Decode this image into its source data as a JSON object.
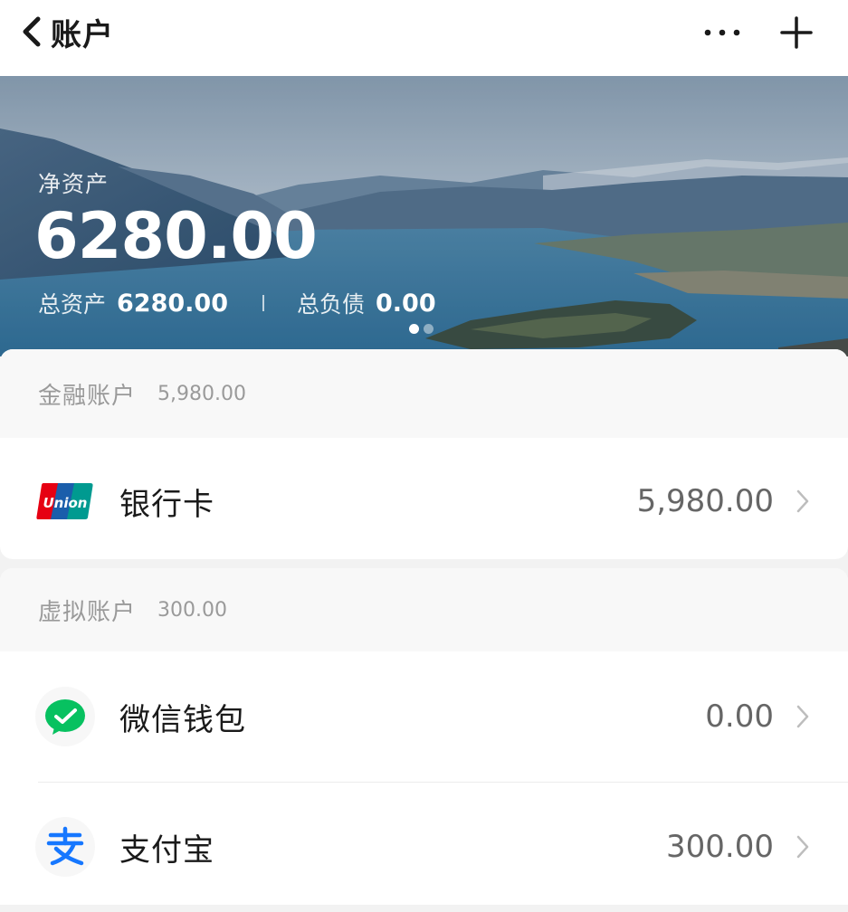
{
  "header": {
    "title": "账户"
  },
  "banner": {
    "net_assets_label": "净资产",
    "net_assets_value": "6280.00",
    "total_assets_label": "总资产",
    "total_assets_value": "6280.00",
    "total_liabilities_label": "总负债",
    "total_liabilities_value": "0.00",
    "carousel_pages": 2,
    "carousel_active_page": 1
  },
  "financial_accounts": {
    "title": "金融账户",
    "total": "5,980.00",
    "items": [
      {
        "name": "银行卡",
        "amount": "5,980.00",
        "icon": "unionpay-icon",
        "icon_text": "Union"
      }
    ]
  },
  "virtual_accounts": {
    "title": "虚拟账户",
    "total": "300.00",
    "items": [
      {
        "name": "微信钱包",
        "amount": "0.00",
        "icon": "wechat-pay-icon"
      },
      {
        "name": "支付宝",
        "amount": "300.00",
        "icon": "alipay-icon"
      }
    ]
  },
  "colors": {
    "wechat_green": "#07c160",
    "alipay_blue": "#1677ff",
    "unionpay_red": "#e60012",
    "unionpay_blue": "#1a5eab",
    "unionpay_green": "#009a90"
  }
}
